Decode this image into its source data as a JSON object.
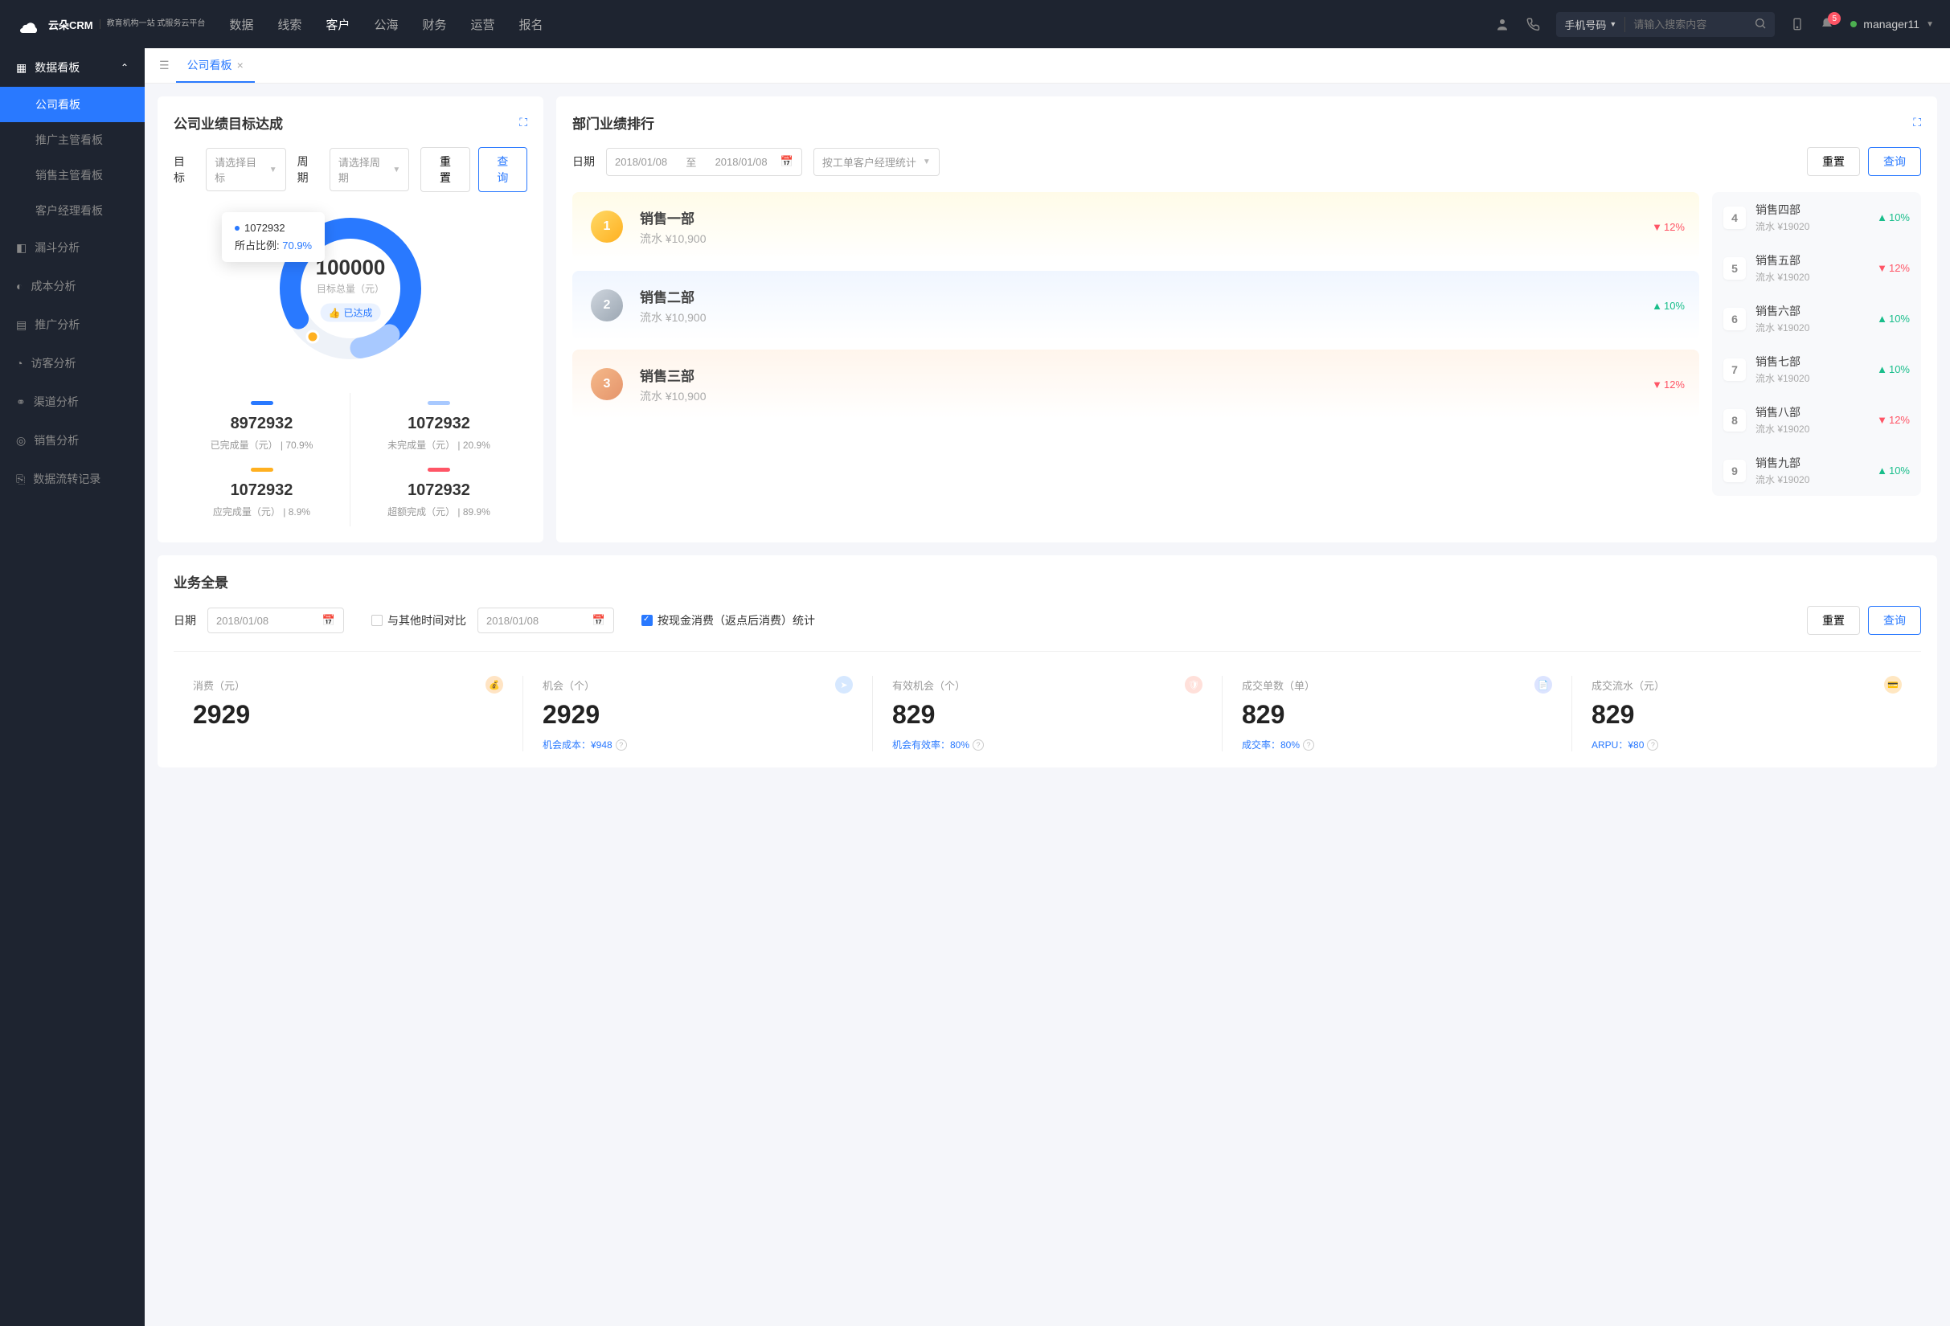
{
  "header": {
    "logo_primary": "云朵CRM",
    "logo_sub": "教育机构一站\n式服务云平台",
    "nav": [
      "数据",
      "线索",
      "客户",
      "公海",
      "财务",
      "运营",
      "报名"
    ],
    "nav_active": 2,
    "search_type": "手机号码",
    "search_placeholder": "请输入搜索内容",
    "notif_count": "5",
    "username": "manager11"
  },
  "sidebar": {
    "groups": [
      {
        "label": "数据看板",
        "expanded": true,
        "subs": [
          "公司看板",
          "推广主管看板",
          "销售主管看板",
          "客户经理看板"
        ],
        "active_sub": 0
      },
      {
        "label": "漏斗分析"
      },
      {
        "label": "成本分析"
      },
      {
        "label": "推广分析"
      },
      {
        "label": "访客分析"
      },
      {
        "label": "渠道分析"
      },
      {
        "label": "销售分析"
      },
      {
        "label": "数据流转记录"
      }
    ]
  },
  "tab": {
    "label": "公司看板"
  },
  "target_card": {
    "title": "公司业绩目标达成",
    "target_label": "目标",
    "target_ph": "请选择目标",
    "period_label": "周期",
    "period_ph": "请选择周期",
    "reset": "重置",
    "query": "查询",
    "tooltip_value": "1072932",
    "tooltip_label": "所占比例:",
    "tooltip_pct": "70.9%",
    "center_value": "100000",
    "center_label": "目标总量（元）",
    "center_badge": "已达成",
    "stats": [
      {
        "color": "#2979ff",
        "value": "8972932",
        "label": "已完成量（元）  |  70.9%"
      },
      {
        "color": "#a8c9ff",
        "value": "1072932",
        "label": "未完成量（元）  |  20.9%"
      },
      {
        "color": "#ffb020",
        "value": "1072932",
        "label": "应完成量（元）  |  8.9%"
      },
      {
        "color": "#f56",
        "value": "1072932",
        "label": "超额完成（元）  |  89.9%"
      }
    ]
  },
  "chart_data": {
    "type": "pie",
    "title": "目标总量（元）",
    "total": 100000,
    "series": [
      {
        "name": "已完成量",
        "value": 70.9,
        "color": "#2979ff"
      },
      {
        "name": "未完成量",
        "value": 20.9,
        "color": "#a8c9ff"
      },
      {
        "name": "应完成量",
        "value": 8.9,
        "color": "#ffb020"
      }
    ]
  },
  "rank_card": {
    "title": "部门业绩排行",
    "date_label": "日期",
    "date_from": "2018/01/08",
    "date_sep": "至",
    "date_to": "2018/01/08",
    "group_by": "按工单客户经理统计",
    "reset": "重置",
    "query": "查询",
    "top3": [
      {
        "rank": "1",
        "name": "销售一部",
        "flow": "流水 ¥10,900",
        "trend": "12%",
        "dir": "down"
      },
      {
        "rank": "2",
        "name": "销售二部",
        "flow": "流水 ¥10,900",
        "trend": "10%",
        "dir": "up"
      },
      {
        "rank": "3",
        "name": "销售三部",
        "flow": "流水 ¥10,900",
        "trend": "12%",
        "dir": "down"
      }
    ],
    "rest": [
      {
        "rank": "4",
        "name": "销售四部",
        "flow": "流水 ¥19020",
        "trend": "10%",
        "dir": "up"
      },
      {
        "rank": "5",
        "name": "销售五部",
        "flow": "流水 ¥19020",
        "trend": "12%",
        "dir": "down"
      },
      {
        "rank": "6",
        "name": "销售六部",
        "flow": "流水 ¥19020",
        "trend": "10%",
        "dir": "up"
      },
      {
        "rank": "7",
        "name": "销售七部",
        "flow": "流水 ¥19020",
        "trend": "10%",
        "dir": "up"
      },
      {
        "rank": "8",
        "name": "销售八部",
        "flow": "流水 ¥19020",
        "trend": "12%",
        "dir": "down"
      },
      {
        "rank": "9",
        "name": "销售九部",
        "flow": "流水 ¥19020",
        "trend": "10%",
        "dir": "up"
      }
    ]
  },
  "overview": {
    "title": "业务全景",
    "date_label": "日期",
    "date1": "2018/01/08",
    "compare_label": "与其他时间对比",
    "date2": "2018/01/08",
    "cash_label": "按现金消费（返点后消费）统计",
    "reset": "重置",
    "query": "查询",
    "items": [
      {
        "label": "消费（元）",
        "icon_bg": "#ffe4c4",
        "icon": "💰",
        "value": "2929",
        "sub": ""
      },
      {
        "label": "机会（个）",
        "icon_bg": "#d6e8ff",
        "icon": "➤",
        "value": "2929",
        "sub": "机会成本：¥948"
      },
      {
        "label": "有效机会（个）",
        "icon_bg": "#ffe0da",
        "icon": "🛡",
        "value": "829",
        "sub": "机会有效率：80%"
      },
      {
        "label": "成交单数（单）",
        "icon_bg": "#dce4ff",
        "icon": "📄",
        "value": "829",
        "sub": "成交率：80%"
      },
      {
        "label": "成交流水（元）",
        "icon_bg": "#ffe7c2",
        "icon": "💳",
        "value": "829",
        "sub": "ARPU：¥80"
      }
    ]
  }
}
